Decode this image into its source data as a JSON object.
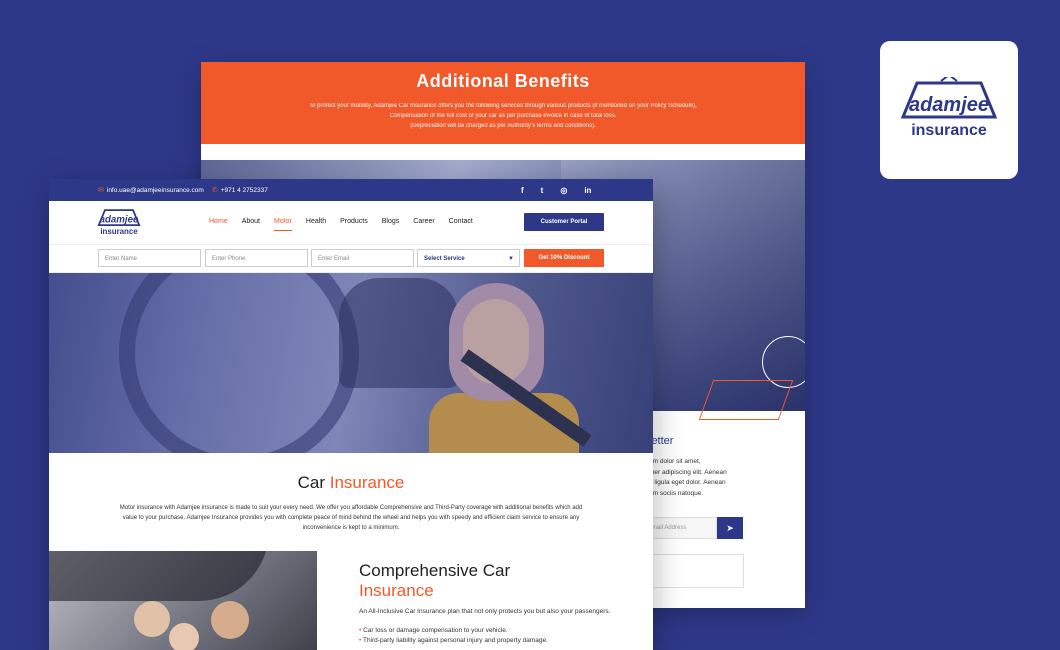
{
  "back_page": {
    "banner_title": "Additional Benefits",
    "banner_lines": [
      "To protect your mobility, Adamjee Car Insurance offers you the following services through various products (if mentioned on your Policy Schedule),",
      "Compensation of the full cost of your car as per purchase invoice in case of total loss.",
      "(Depreciation will be charged as per Authority's terms and conditions)."
    ],
    "newsletter_title": "letter",
    "newsletter_lines": [
      "um dolor sit amet,",
      "tuer adipiscing elit. Aenean",
      "o ligula eget dolor. Aenean",
      "um sociis natoque."
    ],
    "email_placeholder": "mail Address",
    "send_icon": "send-icon"
  },
  "logo": {
    "brand": "adamjee",
    "tagline": "insurance"
  },
  "topbar": {
    "email": "info.uae@adamjeeinsurance.com",
    "phone": "+971 4 2752337",
    "social": [
      "facebook-icon",
      "twitter-icon",
      "instagram-icon",
      "linkedin-icon"
    ],
    "social_glyphs": [
      "f",
      "t",
      "◎",
      "in"
    ]
  },
  "nav": {
    "items": [
      "Home",
      "About",
      "Motor",
      "Health",
      "Products",
      "Blogs",
      "Career",
      "Contact"
    ],
    "portal_label": "Customer Portal"
  },
  "form": {
    "name_placeholder": "Enter Name",
    "phone_placeholder": "Enter Phone",
    "email_placeholder": "Enter Email",
    "service_selected": "Select Service",
    "discount_label": "Get 10% Discount"
  },
  "intro": {
    "title_plain": "Car ",
    "title_accent": "Insurance",
    "body": "Motor insurance with Adamjee insurance is made to suit your every need. We offer you affordable Comprehensive and Third-Party coverage with additional benefits which add value to your purchase. Adamjee Insurance provides you with complete peace of mind behind the wheel and helps you with speedy and efficient claim service to ensure any inconvenience is kept to a minimum."
  },
  "comprehensive": {
    "title_plain": "Comprehensive Car",
    "title_accent": "Insurance",
    "description": "An All-Inclusive Car Insurance plan that not only protects you but also your passengers.",
    "bullets": [
      "Car loss or damage compensation to your vehicle.",
      "Third-party liability against personal injury and property damage."
    ]
  },
  "colors": {
    "brand_blue": "#2e3889",
    "accent_orange": "#f2592a"
  }
}
